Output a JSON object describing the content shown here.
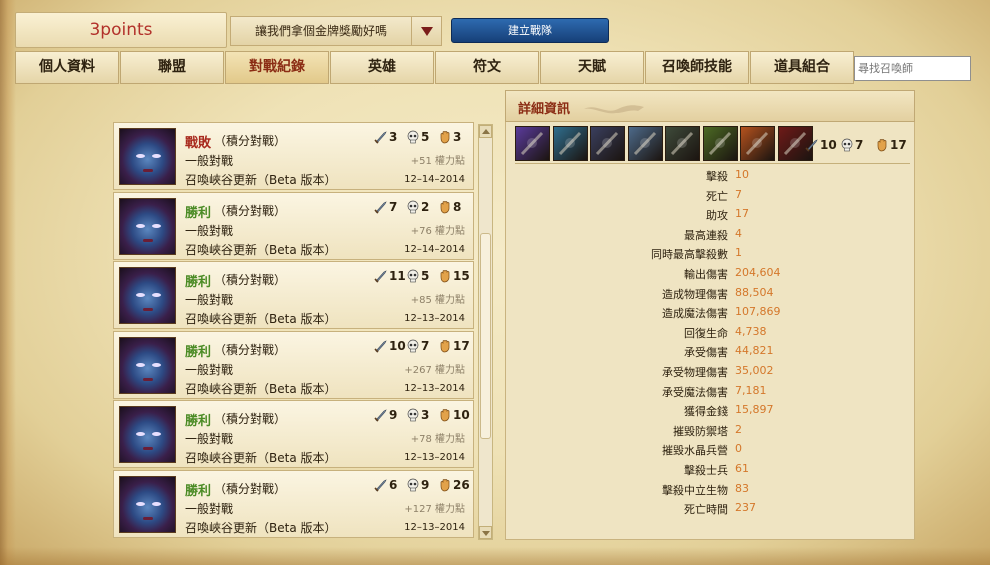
{
  "header": {
    "summoner_name": "3points",
    "team_select_text": "讓我們拿個金牌獎勵好嗎",
    "create_team_label": "建立戰隊"
  },
  "tabs": [
    "個人資料",
    "聯盟",
    "對戰紀錄",
    "英雄",
    "符文",
    "天賦",
    "召喚師技能",
    "道具組合"
  ],
  "active_tab": "對戰紀錄",
  "search": {
    "placeholder": "尋找召喚師"
  },
  "matches": [
    {
      "result": "戰敗",
      "outcome": "loss",
      "mode": "（積分對戰）",
      "type": "一般對戰",
      "map": "召喚峽谷更新（Beta 版本）",
      "kills": "3",
      "deaths": "5",
      "assists": "3",
      "ip": "+51 權力點",
      "date": "12–14–2014"
    },
    {
      "result": "勝利",
      "outcome": "win",
      "mode": "（積分對戰）",
      "type": "一般對戰",
      "map": "召喚峽谷更新（Beta 版本）",
      "kills": "7",
      "deaths": "2",
      "assists": "8",
      "ip": "+76 權力點",
      "date": "12–14–2014"
    },
    {
      "result": "勝利",
      "outcome": "win",
      "mode": "（積分對戰）",
      "type": "一般對戰",
      "map": "召喚峽谷更新（Beta 版本）",
      "kills": "11",
      "deaths": "5",
      "assists": "15",
      "ip": "+85 權力點",
      "date": "12–13–2014"
    },
    {
      "result": "勝利",
      "outcome": "win",
      "mode": "（積分對戰）",
      "type": "一般對戰",
      "map": "召喚峽谷更新（Beta 版本）",
      "kills": "10",
      "deaths": "7",
      "assists": "17",
      "ip": "+267 權力點",
      "date": "12–13–2014"
    },
    {
      "result": "勝利",
      "outcome": "win",
      "mode": "（積分對戰）",
      "type": "一般對戰",
      "map": "召喚峽谷更新（Beta 版本）",
      "kills": "9",
      "deaths": "3",
      "assists": "10",
      "ip": "+78 權力點",
      "date": "12–13–2014"
    },
    {
      "result": "勝利",
      "outcome": "win",
      "mode": "（積分對戰）",
      "type": "一般對戰",
      "map": "召喚峽谷更新（Beta 版本）",
      "kills": "6",
      "deaths": "9",
      "assists": "26",
      "ip": "+127 權力點",
      "date": "12–13–2014"
    }
  ],
  "detail": {
    "title": "詳細資訊",
    "kills": "10",
    "deaths": "7",
    "assists": "17",
    "items": [
      {
        "icon": "purple-sword-item-icon",
        "color": "#5a3b9c"
      },
      {
        "icon": "green-staff-item-icon",
        "color": "#2f6e8e"
      },
      {
        "icon": "tome-item-icon",
        "color": "#3a3f5e"
      },
      {
        "icon": "armor-item-icon",
        "color": "#4d6a8a"
      },
      {
        "icon": "helm-item-icon",
        "color": "#3e4a3a"
      },
      {
        "icon": "green-boots-item-icon",
        "color": "#4c6a24"
      },
      {
        "icon": "fire-blade-item-icon",
        "color": "#b5521e"
      },
      {
        "icon": "red-blade-item-icon",
        "color": "#6e1a18"
      }
    ],
    "stats": [
      {
        "label": "擊殺",
        "value": "10"
      },
      {
        "label": "死亡",
        "value": "7"
      },
      {
        "label": "助攻",
        "value": "17"
      },
      {
        "label": "最高連殺",
        "value": "4"
      },
      {
        "label": "同時最高擊殺數",
        "value": "1"
      },
      {
        "label": "輸出傷害",
        "value": "204,604"
      },
      {
        "label": "造成物理傷害",
        "value": "88,504"
      },
      {
        "label": "造成魔法傷害",
        "value": "107,869"
      },
      {
        "label": "回復生命",
        "value": "4,738"
      },
      {
        "label": "承受傷害",
        "value": "44,821"
      },
      {
        "label": "承受物理傷害",
        "value": "35,002"
      },
      {
        "label": "承受魔法傷害",
        "value": "7,181"
      },
      {
        "label": "獲得金錢",
        "value": "15,897"
      },
      {
        "label": "摧毀防禦塔",
        "value": "2"
      },
      {
        "label": "摧毀水晶兵營",
        "value": "0"
      },
      {
        "label": "擊殺士兵",
        "value": "61"
      },
      {
        "label": "擊殺中立生物",
        "value": "83"
      },
      {
        "label": "死亡時間",
        "value": "237"
      }
    ]
  },
  "colors": {
    "win": "#4b8b25",
    "loss": "#a82a1e",
    "stat_value": "#d4772a",
    "accent": "#8b2c14"
  }
}
